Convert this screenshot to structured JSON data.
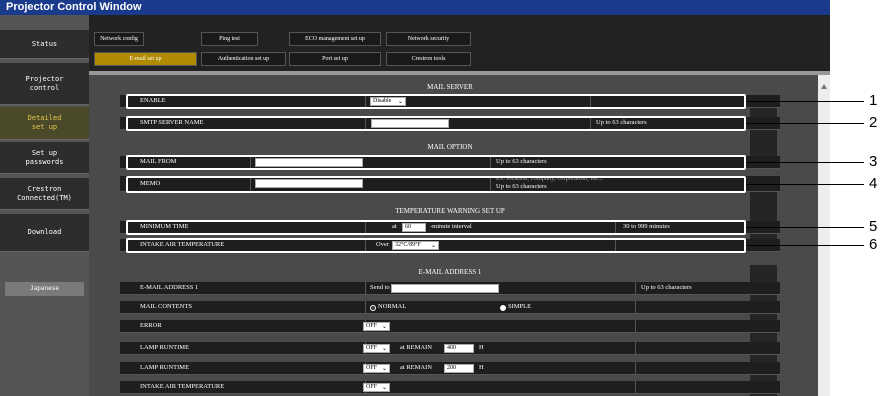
{
  "window_title": "Projector Control Window",
  "sidebar": {
    "items": [
      {
        "label": "Status"
      },
      {
        "label": "Projector\ncontrol"
      },
      {
        "label": "Detailed\nset up"
      },
      {
        "label": "Set up\npasswords"
      },
      {
        "label": "Crestron\nConnected(TM)"
      },
      {
        "label": "Download"
      }
    ],
    "language_button": "Japanese"
  },
  "tabs": {
    "row1": [
      "Network config",
      "Ping test",
      "ECO management set up",
      "Network security"
    ],
    "row2": [
      "E-mail set up",
      "Authentication set up",
      "Port set up",
      "Crestron tools"
    ]
  },
  "mail_server": {
    "title": "MAIL SERVER",
    "enable_label": "ENABLE",
    "enable_value": "Disable",
    "smtp_label": "SMTP SERVER NAME",
    "smtp_value": "",
    "smtp_note": "Up to 63 characters"
  },
  "mail_option": {
    "title": "MAIL OPTION",
    "from_label": "MAIL FROM",
    "from_value": "",
    "from_note": "Up to 63 characters",
    "memo_label": "MEMO",
    "memo_value": "",
    "memo_note1": "Ex. location, company, corporation, etc...",
    "memo_note2": "Up to 63 characters"
  },
  "temp_warning": {
    "title": "TEMPERATURE WARNING SET UP",
    "min_time_label": "MINIMUM TIME",
    "at_text": "at",
    "min_time_value": "60",
    "interval_text": "-minute interval",
    "min_time_note": "30 to 999 minutes",
    "intake_label": "INTAKE AIR TEMPERATURE",
    "over_text": "Over",
    "intake_value": "32°C/89°F"
  },
  "email1": {
    "title": "E-MAIL ADDRESS 1",
    "address_label": "E-MAIL ADDRESS 1",
    "send_to_text": "Send to",
    "address_value": "",
    "address_note": "Up to 63 characters",
    "contents_label": "MAIL CONTENTS",
    "normal_label": "NORMAL",
    "simple_label": "SIMPLE",
    "error_label": "ERROR",
    "error_value": "OFF",
    "lamp1_label": "LAMP RUNTIME",
    "lamp1_value": "OFF",
    "remain_text": "at REMAIN",
    "lamp1_remain": "400",
    "h_text": "H",
    "lamp2_label": "LAMP RUNTIME",
    "lamp2_value": "OFF",
    "lamp2_remain": "200",
    "intake_label": "INTAKE AIR TEMPERATURE",
    "intake_value": "OFF"
  },
  "callouts": [
    "1",
    "2",
    "3",
    "4",
    "5",
    "6"
  ]
}
